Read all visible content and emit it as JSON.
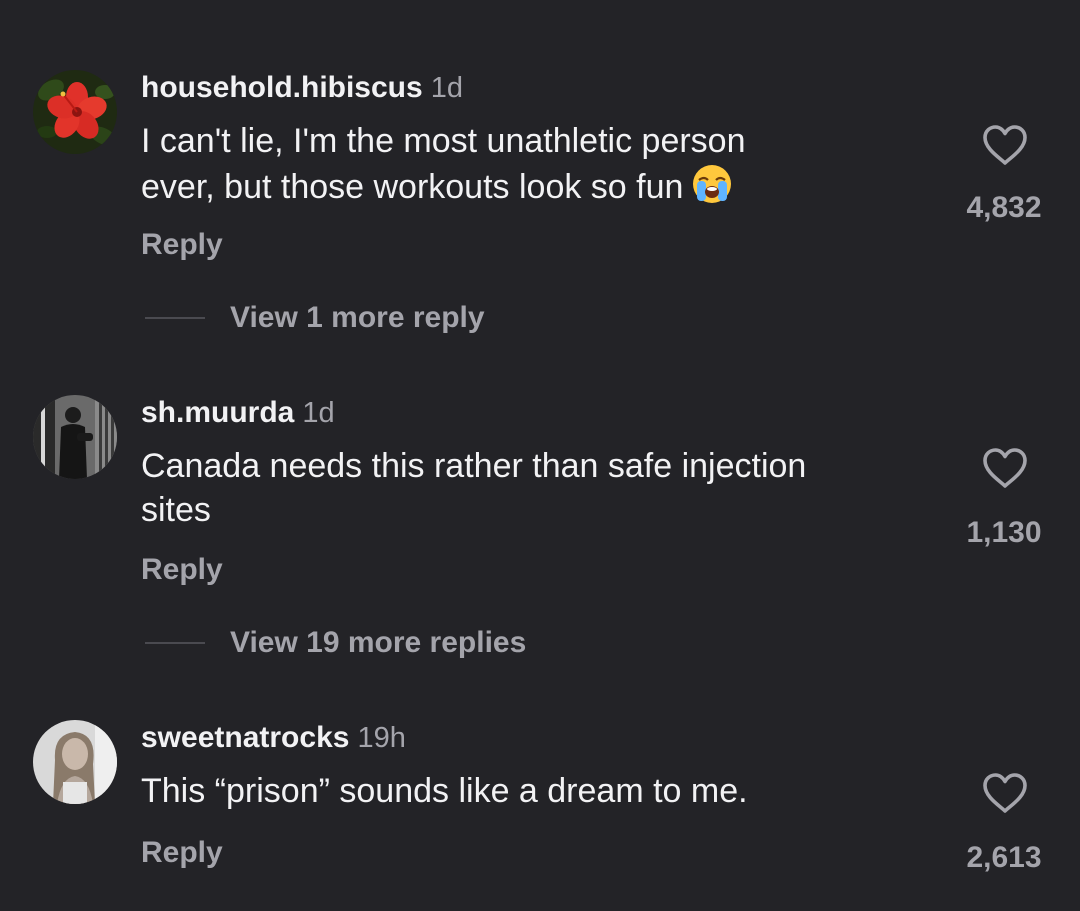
{
  "comments": [
    {
      "username": "household.hibiscus",
      "time": "1d",
      "text_line1": "I can't lie, I'm the most unathletic person",
      "text_line2": "ever, but those workouts look so fun",
      "emoji": "loudly-crying-face-emoji",
      "reply_label": "Reply",
      "view_more_label": "View 1 more reply",
      "likes": "4,832"
    },
    {
      "username": "sh.muurda",
      "time": "1d",
      "text_line1": "Canada needs this rather than safe injection",
      "text_line2": "sites",
      "reply_label": "Reply",
      "view_more_label": "View 19 more replies",
      "likes": "1,130"
    },
    {
      "username": "sweetnatrocks",
      "time": "19h",
      "text_line1": "This “prison” sounds like a dream to me.",
      "reply_label": "Reply",
      "likes": "2,613"
    }
  ],
  "icons": {
    "like": "heart-outline-icon"
  },
  "colors": {
    "background": "#232327",
    "primary_text": "#f2f2f4",
    "secondary_text": "#a4a4ab",
    "hibiscus_red": "#e0312a"
  }
}
